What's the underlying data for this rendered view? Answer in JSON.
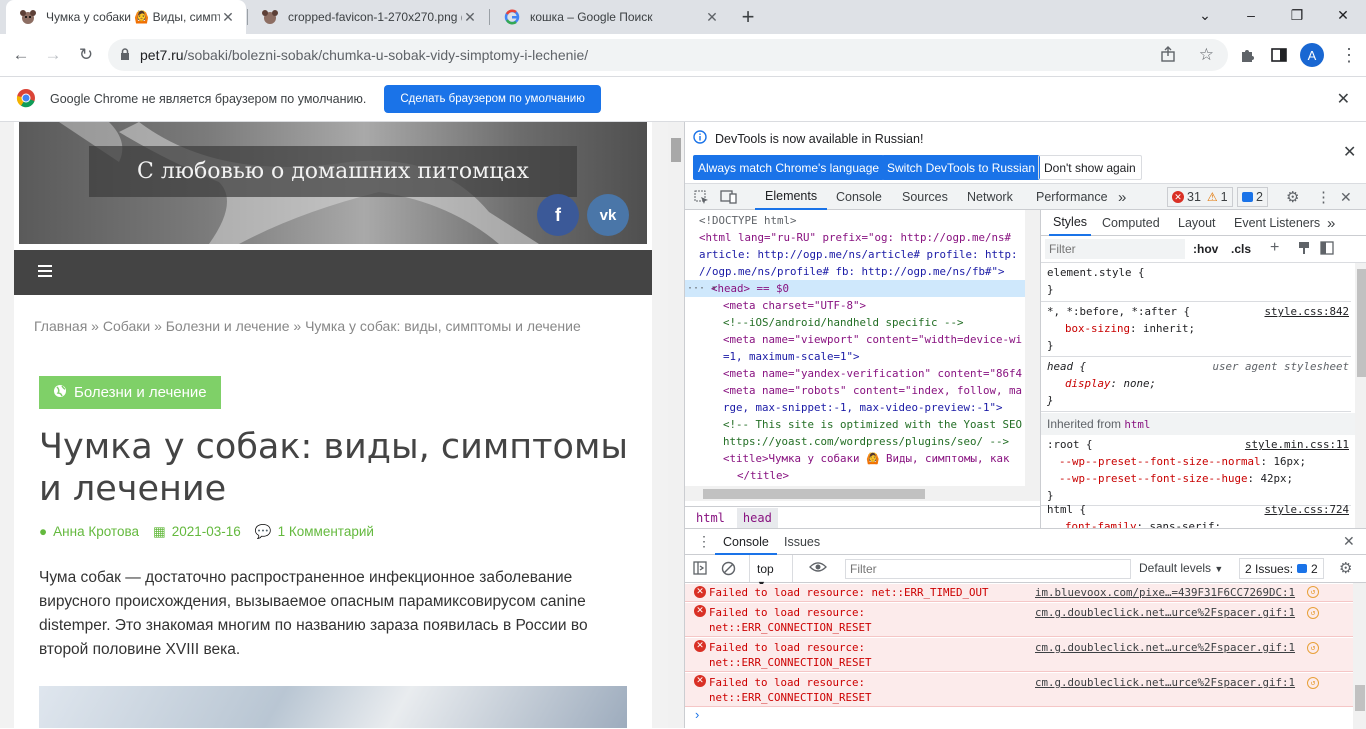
{
  "browser": {
    "tabs": [
      {
        "title": "Чумка у собаки 🙆 Виды, симптом",
        "close": "✕"
      },
      {
        "title": "cropped-favicon-1-270x270.png (27",
        "close": "✕"
      },
      {
        "title": "кошка – Google Поиск",
        "close": "✕"
      }
    ],
    "new_tab": "+",
    "url_domain": "pet7.ru",
    "url_path": "/sobaki/bolezni-sobak/chumka-u-sobak-vidy-simptomy-i-lechenie/",
    "profile_initial": "A"
  },
  "infobar": {
    "message": "Google Chrome не является браузером по умолчанию.",
    "button": "Сделать браузером по умолчанию",
    "close": "✕"
  },
  "page": {
    "tagline": "С любовью о домашних питомцах",
    "social": [
      {
        "label": "f",
        "icon": "facebook-icon"
      },
      {
        "label": "vk",
        "icon": "vk-icon"
      }
    ],
    "breadcrumbs": "Главная » Собаки » Болезни и лечение » Чумка у собак: виды, симптомы и лечение",
    "category": "Болезни и лечение",
    "title": "Чумка у собак: виды, симптомы и лечение",
    "author": "Анна Кротова",
    "date": "2021-03-16",
    "comments": "1 Комментарий",
    "lead": "Чума собак — достаточно распространенное инфекционное заболевание вирусного происхождения, вызываемое опасным парамиксовирусом canine distemper. Это знакомая многим по названию зараза появилась в России во второй половине XVIII века."
  },
  "devtools": {
    "banner": {
      "note": "DevTools is now available in Russian!",
      "btn_match": "Always match Chrome's language",
      "btn_switch": "Switch DevTools to Russian",
      "btn_dismiss": "Don't show again"
    },
    "tabs": [
      "Elements",
      "Console",
      "Sources",
      "Network",
      "Performance"
    ],
    "more": "»",
    "counts": {
      "errors": "31",
      "warnings": "1",
      "issues": "2"
    },
    "elements_lines": [
      "<!DOCTYPE html>",
      "<html lang=\"ru-RU\" prefix=\"og: http://ogp.me/ns#",
      "article: http://ogp.me/ns/article# profile: http:",
      "//ogp.me/ns/profile# fb: http://ogp.me/ns/fb#\">",
      "<head> == $0",
      "<meta charset=\"UTF-8\">",
      "<!--iOS/android/handheld specific -->",
      "<meta name=\"viewport\" content=\"width=device-wi",
      "=1, maximum-scale=1\">",
      "<meta name=\"yandex-verification\" content=\"86f4",
      "<meta name=\"robots\" content=\"index, follow, ma",
      "rge, max-snippet:-1, max-video-preview:-1\">",
      "<!-- This site is optimized with the Yoast SEO",
      "https://yoast.com/wordpress/plugins/seo/ -->",
      "<title>Чумка у собаки 🙆 Виды, симптомы, как ",
      "</title>"
    ],
    "crumbs": [
      "html",
      "head"
    ],
    "styles_tabs": [
      "Styles",
      "Computed",
      "Layout",
      "Event Listeners"
    ],
    "filter_placeholder": "Filter",
    "hov": ":hov",
    "cls": ".cls",
    "rules": {
      "element_style": "element.style {",
      "universal_selector": "*, *:before, *:after {",
      "universal_src": "style.css:842",
      "universal_prop": "box-sizing",
      "universal_val": "inherit;",
      "head_selector": "head {",
      "head_src": "user agent stylesheet",
      "head_prop": "display",
      "head_val": "none;",
      "inherited": "Inherited from",
      "inherited_tag": "html",
      "root_selector": ":root {",
      "root_src": "style.min.css:11",
      "root_p1": "--wp--preset--font-size--normal",
      "root_v1": "16px;",
      "root_p2": "--wp--preset--font-size--huge",
      "root_v2": "42px;",
      "html_selector": "html {",
      "html_src": "style.css:724",
      "html_prop": "font-family",
      "html_val": "sans-serif;",
      "close_brace": "}"
    },
    "drawer": {
      "tabs": [
        "Console",
        "Issues"
      ],
      "context": "top",
      "filter_placeholder": "Filter",
      "levels": "Default levels",
      "issues": "2 Issues:",
      "issues_count": "2",
      "messages": [
        {
          "text": "Failed to load resource: net::ERR_TIMED_OUT",
          "src": "im.bluevoox.com/pixe…=439F31F6CC7269DC:1"
        },
        {
          "text": "Failed to load resource:\nnet::ERR_CONNECTION_RESET",
          "src": "cm.g.doubleclick.net…urce%2Fspacer.gif:1"
        },
        {
          "text": "Failed to load resource:\nnet::ERR_CONNECTION_RESET",
          "src": "cm.g.doubleclick.net…urce%2Fspacer.gif:1"
        },
        {
          "text": "Failed to load resource:\nnet::ERR_CONNECTION_RESET",
          "src": "cm.g.doubleclick.net…urce%2Fspacer.gif:1"
        }
      ],
      "prompt": "›"
    }
  },
  "colors": {
    "accent": "#1a73e8",
    "brand_green": "#7fd068",
    "meta_green": "#64b93e",
    "facebook": "#3b5998",
    "vk": "#4a76a8",
    "error": "#d93025"
  }
}
